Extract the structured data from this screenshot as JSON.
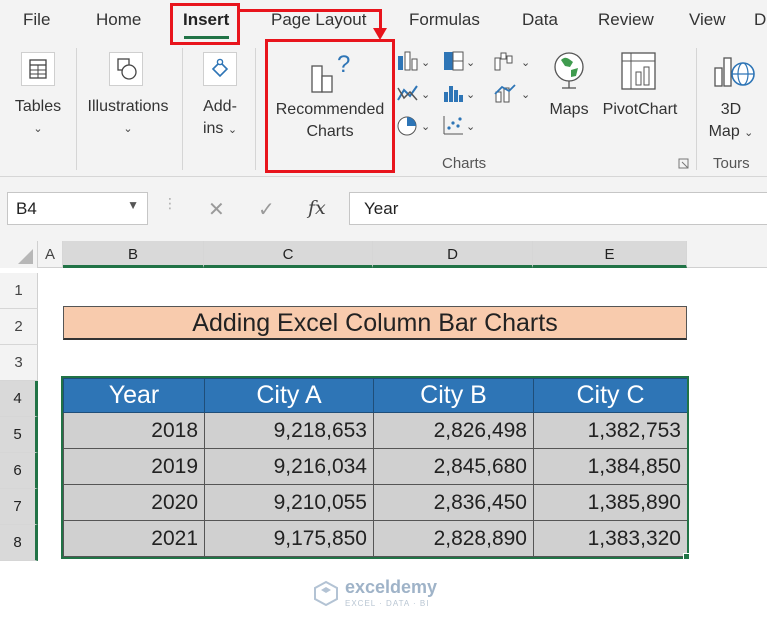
{
  "ribbon_tabs": [
    "File",
    "Home",
    "Insert",
    "Page Layout",
    "Formulas",
    "Data",
    "Review",
    "View",
    "D"
  ],
  "ribbon": {
    "tables": {
      "label": "Tables"
    },
    "illustrations": {
      "label": "Illustrations"
    },
    "addins": {
      "label_line1": "Add-",
      "label_line2": "ins"
    },
    "recommended_charts": {
      "line1": "Recommended",
      "line2": "Charts"
    },
    "maps": {
      "label": "Maps"
    },
    "pivotchart": {
      "label": "PivotChart"
    },
    "map3d": {
      "line1": "3D",
      "line2": "Map"
    },
    "group_charts": "Charts",
    "group_tours": "Tours"
  },
  "formula_bar": {
    "name_box": "B4",
    "fx": "fx",
    "value": "Year"
  },
  "grid": {
    "columns": [
      "A",
      "B",
      "C",
      "D",
      "E"
    ],
    "rows": [
      "1",
      "2",
      "3",
      "4",
      "5",
      "6",
      "7",
      "8"
    ]
  },
  "sheet": {
    "title": "Adding Excel Column Bar Charts",
    "headers": [
      "Year",
      "City A",
      "City B",
      "City C"
    ],
    "rows": [
      [
        "2018",
        "9,218,653",
        "2,826,498",
        "1,382,753"
      ],
      [
        "2019",
        "9,216,034",
        "2,845,680",
        "1,384,850"
      ],
      [
        "2020",
        "9,210,055",
        "2,836,450",
        "1,385,890"
      ],
      [
        "2021",
        "9,175,850",
        "2,828,890",
        "1,383,320"
      ]
    ]
  },
  "watermark": {
    "name": "exceldemy",
    "tagline": "EXCEL · DATA · BI"
  },
  "colors": {
    "accent_green": "#217346",
    "highlight_red": "#e8141c",
    "header_blue": "#2e75b6",
    "title_fill": "#f8cbad",
    "cell_gray": "#d0d0d0"
  }
}
